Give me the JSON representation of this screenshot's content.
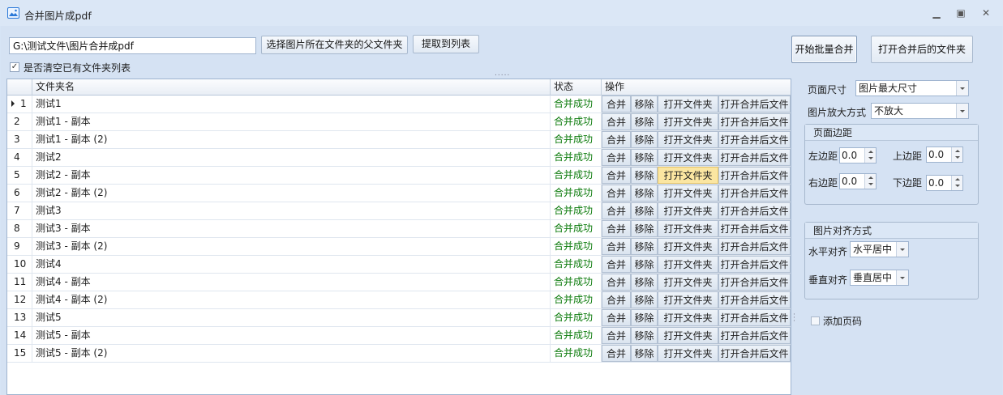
{
  "window": {
    "title": "合并图片成pdf",
    "min_icon": "minimize-icon",
    "max_icon": "maximize-icon",
    "close_icon": "close-icon"
  },
  "toolbar": {
    "path_value": "G:\\测试文件\\图片合并成pdf",
    "select_parent_button": "选择图片所在文件夹的父文件夹",
    "extract_button": "提取到列表",
    "clear_checkbox_label": "是否清空已有文件夹列表",
    "clear_checked": true
  },
  "actions": {
    "batch_merge_button": "开始批量合并",
    "open_merged_folder_button": "打开合并后的文件夹"
  },
  "grid": {
    "columns": {
      "name": "文件夹名",
      "status": "状态",
      "ops": "操作"
    },
    "op_labels": [
      "合并",
      "移除",
      "打开文件夹",
      "打开合并后文件"
    ],
    "highlight": {
      "row": 5,
      "op": 3
    },
    "rows": [
      {
        "no": "1",
        "name": "测试1",
        "status": "合并成功"
      },
      {
        "no": "2",
        "name": "测试1 - 副本",
        "status": "合并成功"
      },
      {
        "no": "3",
        "name": "测试1 - 副本 (2)",
        "status": "合并成功"
      },
      {
        "no": "4",
        "name": "测试2",
        "status": "合并成功"
      },
      {
        "no": "5",
        "name": "测试2 - 副本",
        "status": "合并成功"
      },
      {
        "no": "6",
        "name": "测试2 - 副本 (2)",
        "status": "合并成功"
      },
      {
        "no": "7",
        "name": "测试3",
        "status": "合并成功"
      },
      {
        "no": "8",
        "name": "测试3 - 副本",
        "status": "合并成功"
      },
      {
        "no": "9",
        "name": "测试3 - 副本 (2)",
        "status": "合并成功"
      },
      {
        "no": "10",
        "name": "测试4",
        "status": "合并成功"
      },
      {
        "no": "11",
        "name": "测试4 - 副本",
        "status": "合并成功"
      },
      {
        "no": "12",
        "name": "测试4 - 副本 (2)",
        "status": "合并成功"
      },
      {
        "no": "13",
        "name": "测试5",
        "status": "合并成功"
      },
      {
        "no": "14",
        "name": "测试5 - 副本",
        "status": "合并成功"
      },
      {
        "no": "15",
        "name": "测试5 - 副本 (2)",
        "status": "合并成功"
      }
    ]
  },
  "settings": {
    "page_size_label": "页面尺寸",
    "page_size_value": "图片最大尺寸",
    "zoom_label": "图片放大方式",
    "zoom_value": "不放大",
    "margins": {
      "title": "页面边距",
      "left_label": "左边距",
      "left_value": "0.0",
      "top_label": "上边距",
      "top_value": "0.0",
      "right_label": "右边距",
      "right_value": "0.0",
      "bottom_label": "下边距",
      "bottom_value": "0.0"
    },
    "align": {
      "title": "图片对齐方式",
      "h_label": "水平对齐",
      "h_value": "水平居中",
      "v_label": "垂直对齐",
      "v_value": "垂直居中"
    },
    "page_number_label": "添加页码",
    "page_number_checked": false
  }
}
